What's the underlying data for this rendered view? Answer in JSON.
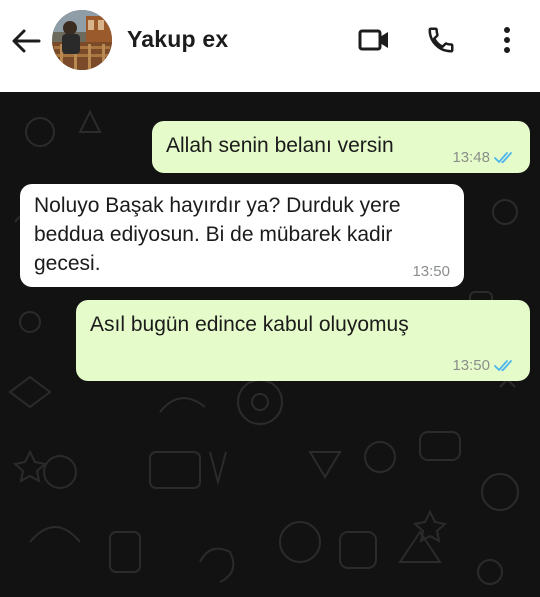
{
  "header": {
    "contact_name": "Yakup ex",
    "icons": [
      "back-arrow-icon",
      "video-call-icon",
      "phone-icon",
      "more-options-icon"
    ]
  },
  "messages": [
    {
      "direction": "outgoing",
      "text": "Allah senin belanı versin",
      "time": "13:48",
      "status": "read"
    },
    {
      "direction": "incoming",
      "text": "Noluyo Başak hayırdır ya? Durduk yere beddua ediyosun. Bi de mübarek kadir gecesi.",
      "time": "13:50"
    },
    {
      "direction": "outgoing",
      "text": "Asıl bugün edince kabul oluyomuş",
      "time": "13:50",
      "status": "read"
    }
  ],
  "colors": {
    "header_bg": "#ffffff",
    "chat_bg": "#121212",
    "outgoing_bubble": "#e5fcca",
    "incoming_bubble": "#ffffff",
    "read_ticks": "#4fb6ec"
  }
}
